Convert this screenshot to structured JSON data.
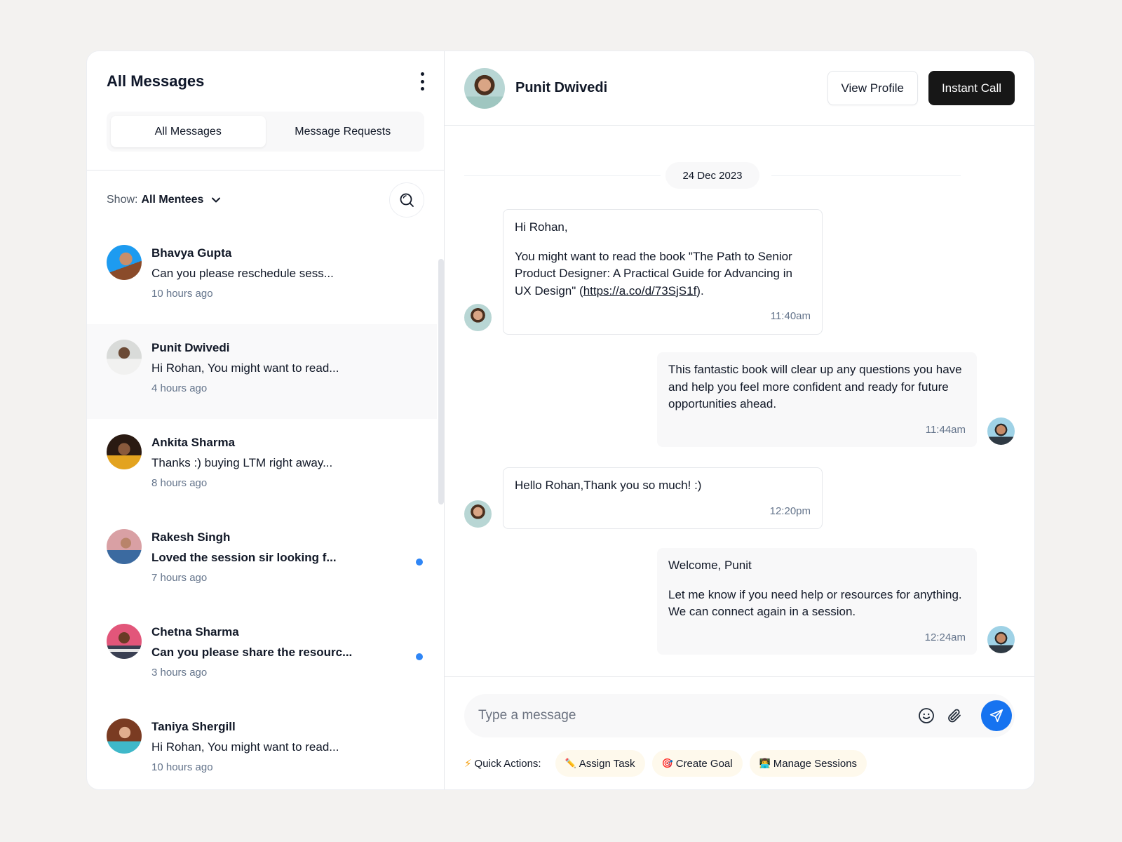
{
  "sidebar": {
    "title": "All Messages",
    "tabs": [
      {
        "label": "All Messages",
        "active": true
      },
      {
        "label": "Message Requests",
        "active": false
      }
    ],
    "filter": {
      "label": "Show:",
      "value": "All Mentees"
    },
    "conversations": [
      {
        "name": "Bhavya Gupta",
        "preview": "Can you please reschedule sess...",
        "time": "10 hours ago",
        "unread": false,
        "selected": false
      },
      {
        "name": "Punit Dwivedi",
        "preview": "Hi Rohan, You might want to read...",
        "time": "4 hours ago",
        "unread": false,
        "selected": true
      },
      {
        "name": "Ankita Sharma",
        "preview": "Thanks :) buying LTM right away...",
        "time": "8 hours ago",
        "unread": false,
        "selected": false
      },
      {
        "name": "Rakesh Singh",
        "preview": "Loved the session sir looking f...",
        "time": "7 hours ago",
        "unread": true,
        "selected": false
      },
      {
        "name": "Chetna Sharma",
        "preview": "Can you please share the resourc...",
        "time": "3 hours ago",
        "unread": true,
        "selected": false
      },
      {
        "name": "Taniya Shergill",
        "preview": "Hi Rohan, You might want to read...",
        "time": "10 hours ago",
        "unread": false,
        "selected": false
      }
    ]
  },
  "chat": {
    "contact_name": "Punit Dwivedi",
    "view_profile_label": "View Profile",
    "instant_call_label": "Instant Call",
    "date_divider": "24 Dec 2023",
    "messages": [
      {
        "direction": "incoming",
        "greeting": "Hi Rohan,",
        "body_before_link": "You might want to read the book \"The Path to Senior Product Designer: A Practical Guide for Advancing in UX Design\" (",
        "link": "https://a.co/d/73SjS1f",
        "body_after_link": ").",
        "time": "11:40am"
      },
      {
        "direction": "outgoing",
        "body": "This fantastic book will clear up any questions you have and help you feel more confident and ready for future opportunities ahead.",
        "time": "11:44am"
      },
      {
        "direction": "incoming",
        "body": "Hello Rohan,Thank you so much! :)",
        "time": "12:20pm"
      },
      {
        "direction": "outgoing",
        "greeting": "Welcome, Punit",
        "body": "Let me know if you need help or resources for anything. We can connect again in a session.",
        "time": "12:24am"
      }
    ],
    "composer": {
      "placeholder": "Type a message",
      "value": "",
      "quick_actions_label": "Quick Actions:",
      "quick_actions": [
        {
          "emoji": "✏️",
          "label": "Assign Task"
        },
        {
          "emoji": "🎯",
          "label": "Create Goal"
        },
        {
          "emoji": "👨‍💻",
          "label": "Manage Sessions"
        }
      ]
    }
  },
  "colors": {
    "accent_blue": "#1673f0",
    "unread_dot": "#2f86f6",
    "dark_button": "#171717",
    "chip_bg": "#fef9ec"
  }
}
